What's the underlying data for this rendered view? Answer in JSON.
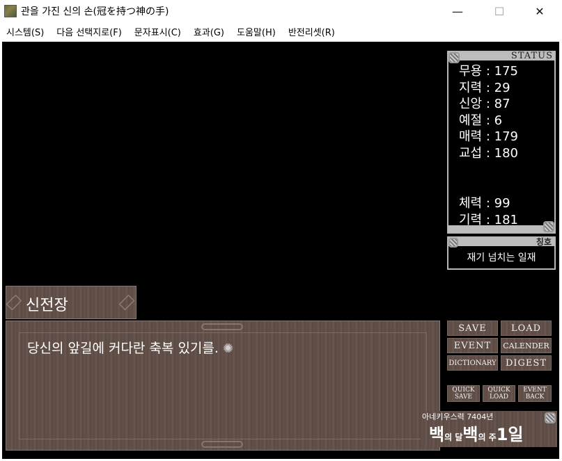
{
  "window": {
    "title": "관을 가진 신의 손(冠を持つ神の手)",
    "minimize_glyph": "—",
    "maximize_glyph": "☐",
    "close_glyph": "✕"
  },
  "menu": [
    "시스템(S)",
    "다음 선택지로(F)",
    "문자표시(C)",
    "효과(G)",
    "도움말(H)",
    "반전리셋(R)"
  ],
  "status": {
    "header": "STATUS",
    "stats": [
      "무용 : 175",
      "지력 : 29",
      "신앙 : 87",
      "예절 : 6",
      "매력 : 179",
      "교섭 : 180"
    ],
    "vitals": [
      "체력 : 99",
      "기력 : 181"
    ]
  },
  "title_panel": {
    "header": "칭호",
    "value": "재기 넘치는 일재"
  },
  "dialogue": {
    "speaker": "신전장",
    "text": "당신의 앞길에 커다란 축복 있기를.",
    "cursor": "✺"
  },
  "buttons": {
    "save": "SAVE",
    "load": "LOAD",
    "event": "EVENT",
    "calender": "CALENDER",
    "dictionary": "DICTIONARY",
    "digest": "DIGEST",
    "quick_save": [
      "QUICK",
      "SAVE"
    ],
    "quick_load": [
      "QUICK",
      "LOAD"
    ],
    "event_back": [
      "EVENT",
      "BACK"
    ]
  },
  "date": {
    "calendar": "아네키우스력 7404년",
    "month": "백",
    "of1": "의 달",
    "week": "백",
    "of2": "의 주",
    "day": "1일"
  },
  "colors": {
    "stage_bg": "#000000",
    "panel_wood": "#5d4c45",
    "panel_border": "#b8b8b8"
  }
}
